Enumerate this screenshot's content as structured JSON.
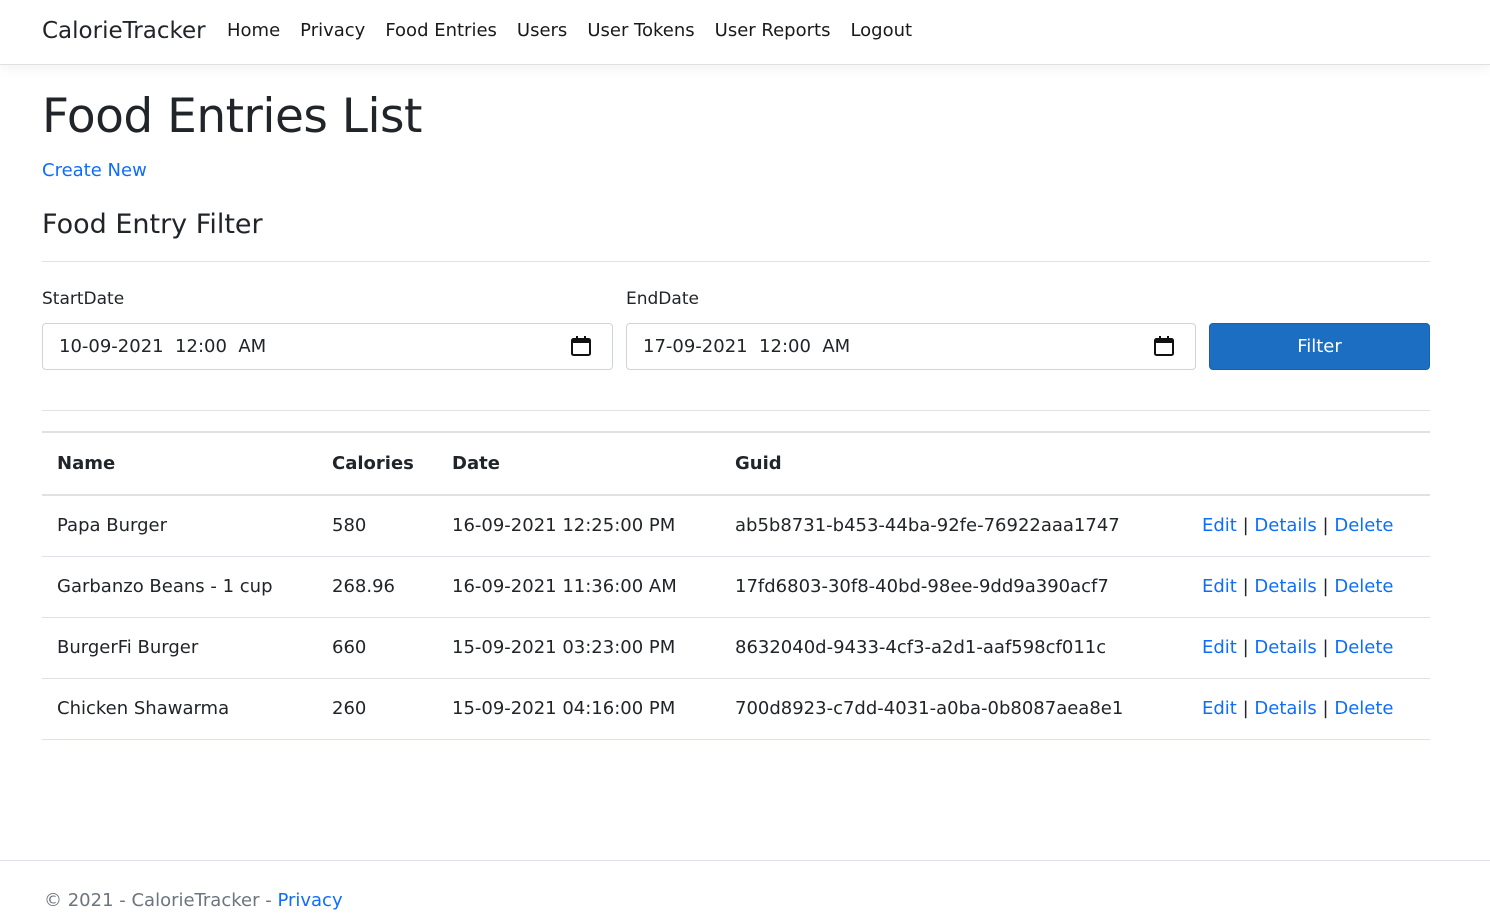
{
  "navbar": {
    "brand": "CalorieTracker",
    "links": [
      "Home",
      "Privacy",
      "Food Entries",
      "Users",
      "User Tokens",
      "User Reports",
      "Logout"
    ]
  },
  "page": {
    "title": "Food Entries List",
    "create_link": "Create New",
    "filter_title": "Food Entry Filter"
  },
  "filter": {
    "start_label": "StartDate",
    "start_value": "10-09-2021  12:00  AM",
    "end_label": "EndDate",
    "end_value": "17-09-2021  12:00  AM",
    "button_label": "Filter",
    "calendar_icon": "calendar-icon"
  },
  "table": {
    "headers": [
      "Name",
      "Calories",
      "Date",
      "Guid",
      ""
    ],
    "rows": [
      {
        "name": "Papa Burger",
        "calories": "580",
        "date": "16-09-2021 12:25:00 PM",
        "guid": "ab5b8731-b453-44ba-92fe-76922aaa1747"
      },
      {
        "name": "Garbanzo Beans - 1 cup",
        "calories": "268.96",
        "date": "16-09-2021 11:36:00 AM",
        "guid": "17fd6803-30f8-40bd-98ee-9dd9a390acf7"
      },
      {
        "name": "BurgerFi Burger",
        "calories": "660",
        "date": "15-09-2021 03:23:00 PM",
        "guid": "8632040d-9433-4cf3-a2d1-aaf598cf011c"
      },
      {
        "name": "Chicken Shawarma",
        "calories": "260",
        "date": "15-09-2021 04:16:00 PM",
        "guid": "700d8923-c7dd-4031-a0ba-0b8087aea8e1"
      }
    ],
    "actions": {
      "edit": "Edit",
      "details": "Details",
      "delete": "Delete",
      "separator": "|"
    }
  },
  "footer": {
    "copyright": "© 2021 - CalorieTracker - ",
    "privacy_link": "Privacy"
  },
  "colors": {
    "link": "#0d6efd",
    "primary_button": "#1b6ec2",
    "border": "#dee2e6",
    "muted": "#6c757d"
  }
}
